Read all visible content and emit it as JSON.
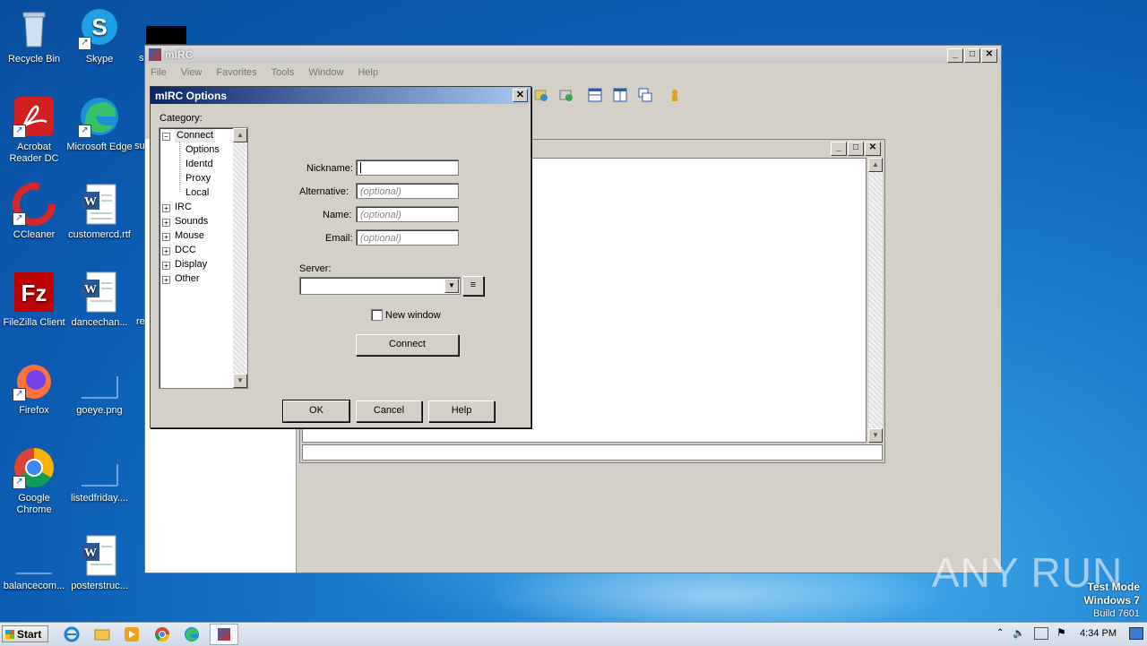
{
  "desktop": {
    "icons": [
      {
        "name": "recycle-bin",
        "label": "Recycle Bin"
      },
      {
        "name": "skype",
        "label": "Skype"
      },
      {
        "name": "acrobat",
        "label": "Acrobat Reader DC"
      },
      {
        "name": "edge",
        "label": "Microsoft Edge"
      },
      {
        "name": "ccleaner",
        "label": "CCleaner"
      },
      {
        "name": "customercd",
        "label": "customercd.rtf"
      },
      {
        "name": "filezilla",
        "label": "FileZilla Client"
      },
      {
        "name": "dancechan",
        "label": "dancechan..."
      },
      {
        "name": "firefox",
        "label": "Firefox"
      },
      {
        "name": "goeye",
        "label": "goeye.png"
      },
      {
        "name": "chrome",
        "label": "Google Chrome"
      },
      {
        "name": "listedfriday",
        "label": "listedfriday...."
      },
      {
        "name": "balancecom",
        "label": "balancecom..."
      },
      {
        "name": "posterstruc",
        "label": "posterstruc..."
      }
    ],
    "partial_labels": {
      "s": "s",
      "su": "su",
      "re": "re"
    }
  },
  "mirc": {
    "title": "mIRC",
    "menu": [
      "File",
      "View",
      "Favorites",
      "Tools",
      "Window",
      "Help"
    ]
  },
  "options": {
    "title": "mIRC Options",
    "category_label": "Category:",
    "tree": {
      "connect": "Connect",
      "children": [
        "Options",
        "Identd",
        "Proxy",
        "Local"
      ],
      "groups": [
        "IRC",
        "Sounds",
        "Mouse",
        "DCC",
        "Display",
        "Other"
      ]
    },
    "nickname_label": "Nickname:",
    "nickname_value": "",
    "alternative_label": "Alternative:",
    "name_label": "Name:",
    "email_label": "Email:",
    "optional_placeholder": "(optional)",
    "server_label": "Server:",
    "new_window_label": "New window",
    "connect_button": "Connect",
    "ok_button": "OK",
    "cancel_button": "Cancel",
    "help_button": "Help"
  },
  "taskbar": {
    "start_label": "Start",
    "time": "4:34 PM"
  },
  "watermark": {
    "line1": "Test Mode",
    "line2": "Windows 7",
    "line3": "Build 7601",
    "brand": "ANY RUN"
  }
}
